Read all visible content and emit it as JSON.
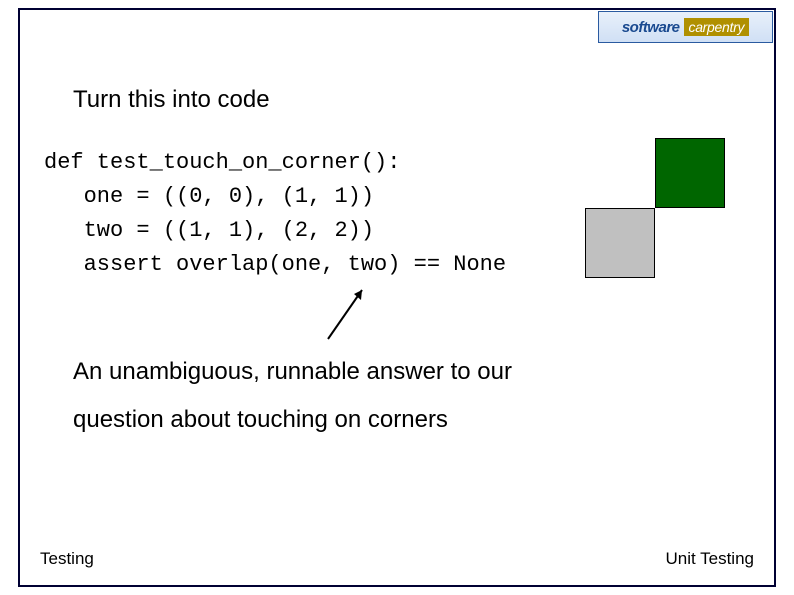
{
  "logo": {
    "word1": "software",
    "word2": "carpentry",
    "tagline": ""
  },
  "heading": "Turn this into code",
  "code": {
    "line1": "def test_touch_on_corner():",
    "line2": "   one = ((0, 0), (1, 1))",
    "line3": "   two = ((1, 1), (2, 2))",
    "line4": "   assert overlap(one, two) == None"
  },
  "squares": {
    "upper_color": "#006600",
    "lower_color": "#c0c0c0"
  },
  "explain": {
    "line1": "An unambiguous, runnable answer to our",
    "line2": "question about touching on corners"
  },
  "footer": {
    "left": "Testing",
    "right": "Unit Testing"
  }
}
